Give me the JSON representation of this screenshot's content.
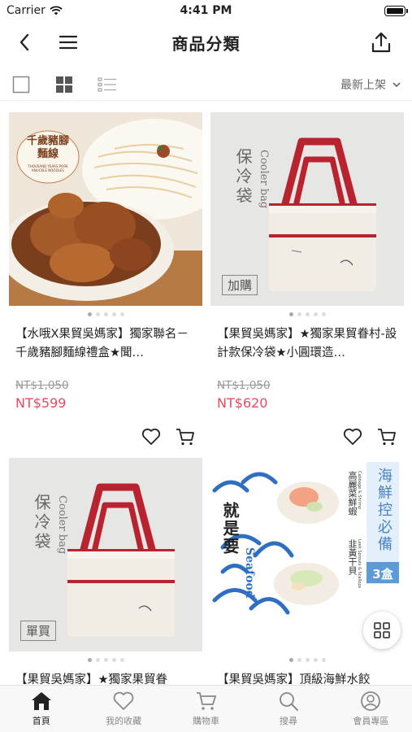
{
  "status_bar": {
    "carrier": "Carrier",
    "time": "4:41 PM"
  },
  "nav": {
    "title": "商品分類",
    "back_icon": "chevron-left-icon",
    "menu_icon": "hamburger-icon",
    "share_icon": "share-icon"
  },
  "toolbar": {
    "sort_label": "最新上架"
  },
  "products": [
    {
      "name": "【水哦Ⅹ果貿吳媽家】獨家聯名－千歲豬腳麵線禮盒★聞…",
      "original_price": "NT$1,050",
      "price": "NT$599",
      "img_text": {
        "title": "千歲豬腳麵線",
        "sub": "THOUSAND YEARS PORK KNUCKLE NOODLES"
      }
    },
    {
      "name": "【果貿吳媽家】★獨家果貿眷村-設計款保冷袋★小圓環造…",
      "original_price": "NT$1,050",
      "price": "NT$620",
      "img_text": {
        "zh": "保冷袋",
        "en": "Cooler bag",
        "tag": "加購"
      }
    },
    {
      "name": "【果貿吳媽家】★獨家果貿眷",
      "img_text": {
        "zh": "保冷袋",
        "en": "Cooler bag",
        "tag": "單買"
      }
    },
    {
      "name": "【果貿吳媽家】頂級海鮮水餃",
      "img_text": {
        "main": "就是要",
        "en": "Seafood",
        "box_title": "海鮮控必備",
        "box_count": "3盒",
        "flavor1": "高麗菜鮮蝦",
        "flavor1_en": "Cabbage & Shrimp",
        "flavor2": "韭黃干貝",
        "flavor2_en": "Leek Sprouts & Scallops"
      }
    }
  ],
  "tabs": [
    {
      "label": "首頁",
      "icon": "home-icon",
      "active": true
    },
    {
      "label": "我的收藏",
      "icon": "heart-icon",
      "active": false
    },
    {
      "label": "購物車",
      "icon": "cart-icon",
      "active": false
    },
    {
      "label": "搜尋",
      "icon": "search-icon",
      "active": false
    },
    {
      "label": "會員專區",
      "icon": "user-icon",
      "active": false
    }
  ],
  "colors": {
    "price": "#e84a5f",
    "bag_red": "#b8232f",
    "sea_blue": "#2e6fc2"
  }
}
